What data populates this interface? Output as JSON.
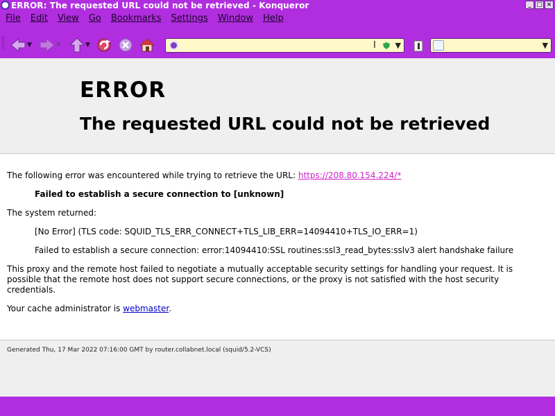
{
  "window": {
    "title": "ERROR: The requested URL could not be retrieved - Konqueror",
    "buttons": {
      "minimize": "_",
      "maximize": "□",
      "close": "×"
    }
  },
  "menu": [
    {
      "label": "File"
    },
    {
      "label": "Edit"
    },
    {
      "label": "View"
    },
    {
      "label": "Go"
    },
    {
      "label": "Bookmarks"
    },
    {
      "label": "Settings"
    },
    {
      "label": "Window"
    },
    {
      "label": "Help"
    }
  ],
  "toolbar": {
    "icons": [
      "back-icon",
      "forward-icon",
      "up-icon",
      "reload-icon",
      "stop-icon",
      "home-icon",
      "clear-location-icon"
    ],
    "location": {
      "value": "",
      "placeholder": ""
    },
    "search": {
      "value": "",
      "placeholder": ""
    }
  },
  "page": {
    "heading": "ERROR",
    "subheading": "The requested URL could not be retrieved",
    "intro_text": "The following error was encountered while trying to retrieve the URL:",
    "intro_url": "https://208.80.154.224/*",
    "failure": "Failed to establish a secure connection to [unknown]",
    "system_returned": "The system returned:",
    "error_code": "[No Error] (TLS code: SQUID_TLS_ERR_CONNECT+TLS_LIB_ERR=14094410+TLS_IO_ERR=1)",
    "error_detail": "Failed to establish a secure connection: error:14094410:SSL routines:ssl3_read_bytes:sslv3 alert handshake failure",
    "explanation": "This proxy and the remote host failed to negotiate a mutually acceptable security settings for handling your request. It is possible that the remote host does not support secure connections, or the proxy is not satisfied with the host security credentials.",
    "admin_text": "Your cache administrator is",
    "admin_link": "webmaster",
    "admin_suffix": ".",
    "footer": "Generated Thu, 17 Mar 2022 07:16:00 GMT by router.collabnet.local (squid/5.2-VCS)"
  },
  "colors": {
    "chrome": "#b12ee0",
    "link": "#cc22cc",
    "mail_link": "#0000cc",
    "header_bg": "#efefef"
  }
}
